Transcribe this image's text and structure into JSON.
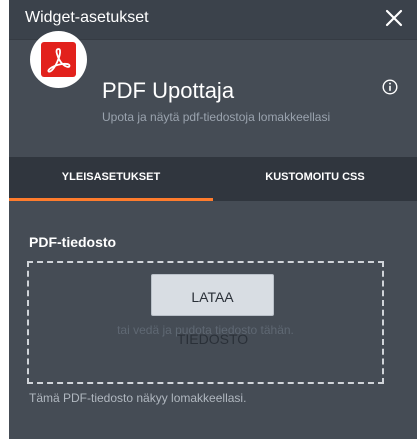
{
  "dialog": {
    "title": "Widget-asetukset",
    "close_icon": "close-icon"
  },
  "widget": {
    "icon": "adobe-acrobat-pdf-icon",
    "name": "PDF Upottaja",
    "description": "Upota ja näytä pdf-tiedostoja lomakkeellasi",
    "info_icon": "info-icon"
  },
  "tabs": [
    {
      "label": "YLEISASETUKSET",
      "active": true
    },
    {
      "label": "KUSTOMOITU CSS",
      "active": false
    }
  ],
  "form": {
    "field_label": "PDF-tiedosto",
    "upload_button": "LATAA TIEDOSTO",
    "drop_hint": "tai vedä ja pudota tiedosto tähän.",
    "help_text": "Tämä PDF-tiedosto näkyy lomakkeellasi."
  },
  "colors": {
    "panel_bg": "#454c55",
    "tabbar_bg": "#30363e",
    "active_tab_accent": "#ff7c2d",
    "brand_red": "#e2211c"
  }
}
